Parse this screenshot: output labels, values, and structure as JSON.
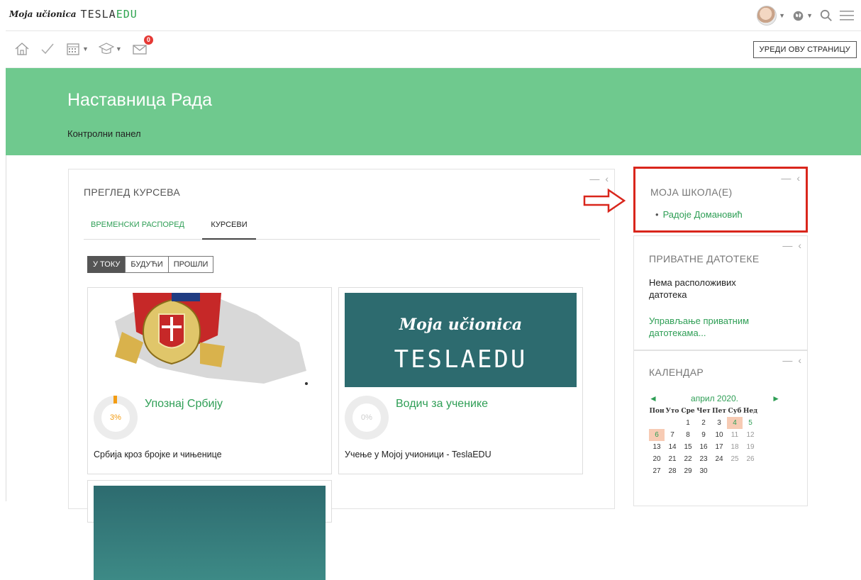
{
  "header": {
    "logo_script": "Moja učionica",
    "logo_brand_a": "TESLA",
    "logo_brand_b": "EDU",
    "edit_button": "УРЕДИ ОВУ СТРАНИЦУ",
    "messages_badge": "0"
  },
  "page": {
    "title": "Наставница Рада",
    "breadcrumb": "Контролни панел"
  },
  "overview": {
    "title": "ПРЕГЛЕД КУРСЕВА",
    "tabs": [
      "ВРЕМЕНСКИ РАСПОРЕД",
      "КУРСЕВИ"
    ],
    "filters": [
      "У ТОКУ",
      "БУДУЋИ",
      "ПРОШЛИ"
    ],
    "courses": [
      {
        "name": "Упознај Србију",
        "progress": "3%",
        "desc": "Србија кроз бројке и чињенице"
      },
      {
        "name": "Водич за ученике",
        "progress": "0%",
        "desc": "Учење у Мојој учионици - TeslaEDU",
        "image_text_a": "Moja učionica",
        "image_text_b": "TESLAEDU"
      }
    ]
  },
  "school": {
    "title": "МОЈА ШКОЛА(Е)",
    "item": "Радоје Домановић"
  },
  "private_files": {
    "title": "ПРИВАТНЕ ДАТОТЕКЕ",
    "empty": "Нема расположивих датотека",
    "manage": "Управљање приватним датотекама..."
  },
  "calendar": {
    "title": "КАЛЕНДАР",
    "month": "април 2020.",
    "prev": "◄",
    "next": "►",
    "days": [
      "Пон",
      "Уто",
      "Сре",
      "Чет",
      "Пет",
      "Суб",
      "Нед"
    ],
    "weeks": [
      [
        "",
        "",
        "1",
        "2",
        "3",
        "4",
        "5"
      ],
      [
        "6",
        "7",
        "8",
        "9",
        "10",
        "11",
        "12"
      ],
      [
        "13",
        "14",
        "15",
        "16",
        "17",
        "18",
        "19"
      ],
      [
        "20",
        "21",
        "22",
        "23",
        "24",
        "25",
        "26"
      ],
      [
        "27",
        "28",
        "29",
        "30",
        "",
        "",
        ""
      ]
    ]
  },
  "colors": {
    "accent": "#2e9e55",
    "band": "#6fc98e",
    "highlight": "#d9261c"
  }
}
